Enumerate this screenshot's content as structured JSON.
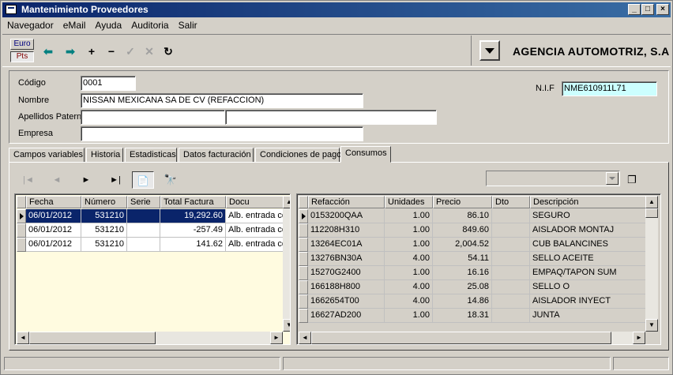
{
  "window": {
    "title": "Mantenimiento Proveedores",
    "minimize": "_",
    "maximize": "□",
    "close": "×"
  },
  "menu": [
    "Navegador",
    "eMail",
    "Ayuda",
    "Auditoria",
    "Salir"
  ],
  "toolbar": {
    "currency_euro": "Euro",
    "currency_pts": "Pts",
    "prev_icon": "arrow-left-icon",
    "next_icon": "arrow-right-icon",
    "add_icon": "plus-icon",
    "remove_icon": "minus-icon",
    "confirm_icon": "check-icon",
    "cancel_icon": "x-icon",
    "refresh_icon": "refresh-icon",
    "company_name": "AGENCIA AUTOMOTRIZ, S.A"
  },
  "form": {
    "codigo_label": "Código",
    "codigo_value": "0001",
    "nombre_label": "Nombre",
    "nombre_value": "NISSAN MEXICANA SA DE CV (REFACCION)",
    "apellidos_label": "Apellidos Paterno",
    "apellido_paterno_value": "",
    "apellido_materno_value": "",
    "empresa_label": "Empresa",
    "empresa_value": "",
    "nif_label": "N.I.F",
    "nif_value": "NME610911L71"
  },
  "tabs": [
    "Campos variables",
    "Historia",
    "Estadisticas",
    "Datos facturación",
    "Condiciones de pago",
    "Consumos"
  ],
  "active_tab": "Consumos",
  "nav": {
    "first": "|◄",
    "prev": "◄",
    "next": "►",
    "last": "►|"
  },
  "left_grid": {
    "columns": [
      "Fecha",
      "Número",
      "Serie",
      "Total Factura",
      "Docu"
    ],
    "rows": [
      [
        "06/01/2012",
        "531210",
        "",
        "19,292.60",
        "Alb. entrada co"
      ],
      [
        "06/01/2012",
        "531210",
        "",
        "-257.49",
        "Alb. entrada co"
      ],
      [
        "06/01/2012",
        "531210",
        "",
        "141.62",
        "Alb. entrada co"
      ]
    ]
  },
  "right_grid": {
    "columns": [
      "Refacción",
      "Unidades",
      "Precio",
      "Dto",
      "Descripción"
    ],
    "rows": [
      [
        "0153200QAA",
        "1.00",
        "86.10",
        "",
        "SEGURO"
      ],
      [
        "112208H310",
        "1.00",
        "849.60",
        "",
        "AISLADOR MONTAJ"
      ],
      [
        "13264EC01A",
        "1.00",
        "2,004.52",
        "",
        "CUB BALANCINES"
      ],
      [
        "13276BN30A",
        "4.00",
        "54.11",
        "",
        "SELLO ACEITE"
      ],
      [
        "15270G2400",
        "1.00",
        "16.16",
        "",
        "EMPAQ/TAPON SUM"
      ],
      [
        "166188H800",
        "4.00",
        "25.08",
        "",
        "SELLO O"
      ],
      [
        "1662654T00",
        "4.00",
        "14.86",
        "",
        "AISLADOR INYECT"
      ],
      [
        "16627AD200",
        "1.00",
        "18.31",
        "",
        "JUNTA"
      ]
    ]
  },
  "colors": {
    "title_bar": "#0a246a",
    "selection": "#0a246a",
    "grid_bg": "#fffbe0",
    "nif_bg": "#ccffff"
  }
}
